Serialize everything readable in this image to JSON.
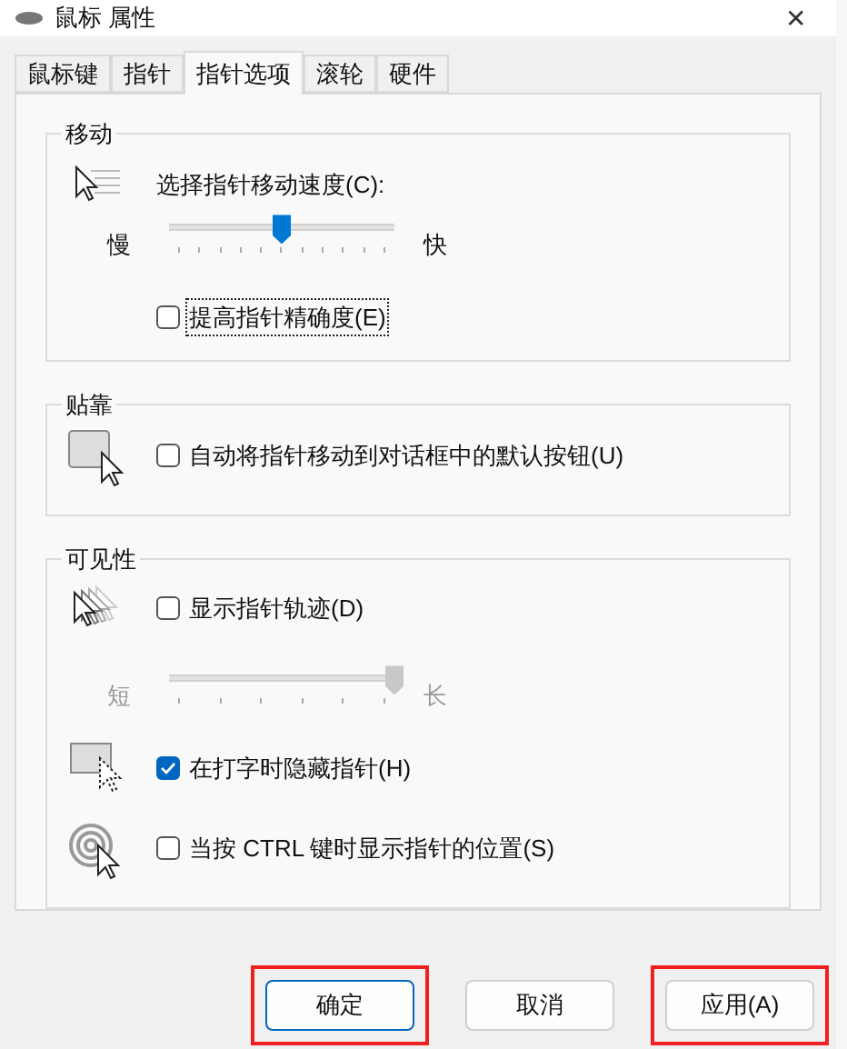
{
  "window": {
    "title": "鼠标 属性",
    "close": "✕"
  },
  "tabs": [
    {
      "label": "鼠标键",
      "selected": false
    },
    {
      "label": "指针",
      "selected": false
    },
    {
      "label": "指针选项",
      "selected": true
    },
    {
      "label": "滚轮",
      "selected": false
    },
    {
      "label": "硬件",
      "selected": false
    }
  ],
  "groups": [
    {
      "title": "移动",
      "rows": [
        {
          "kind": "slider",
          "label": "选择指针移动速度(C):",
          "min_label": "慢",
          "max_label": "快",
          "level": 0.5,
          "disabled": false
        },
        {
          "kind": "checkbox",
          "label": "提高指针精确度(E)",
          "checked": false,
          "focused": true
        }
      ]
    },
    {
      "title": "贴靠",
      "rows": [
        {
          "kind": "checkbox",
          "label": "自动将指针移动到对话框中的默认按钮(U)",
          "checked": false,
          "focused": false
        }
      ]
    },
    {
      "title": "可见性",
      "rows": [
        {
          "kind": "checkbox",
          "label": "显示指针轨迹(D)",
          "checked": false,
          "focused": false
        },
        {
          "kind": "slider",
          "min_label": "短",
          "max_label": "长",
          "level": 1,
          "disabled": true
        },
        {
          "kind": "checkbox",
          "label": "在打字时隐藏指针(H)",
          "checked": true,
          "focused": false
        },
        {
          "kind": "checkbox",
          "label": "当按 CTRL 键时显示指针的位置(S)",
          "checked": false,
          "focused": false
        }
      ]
    }
  ],
  "buttons": [
    {
      "label": "确定",
      "default": true,
      "highlighted": true
    },
    {
      "label": "取消",
      "default": false,
      "highlighted": false
    },
    {
      "label": "应用(A)",
      "default": false,
      "highlighted": true
    }
  ]
}
